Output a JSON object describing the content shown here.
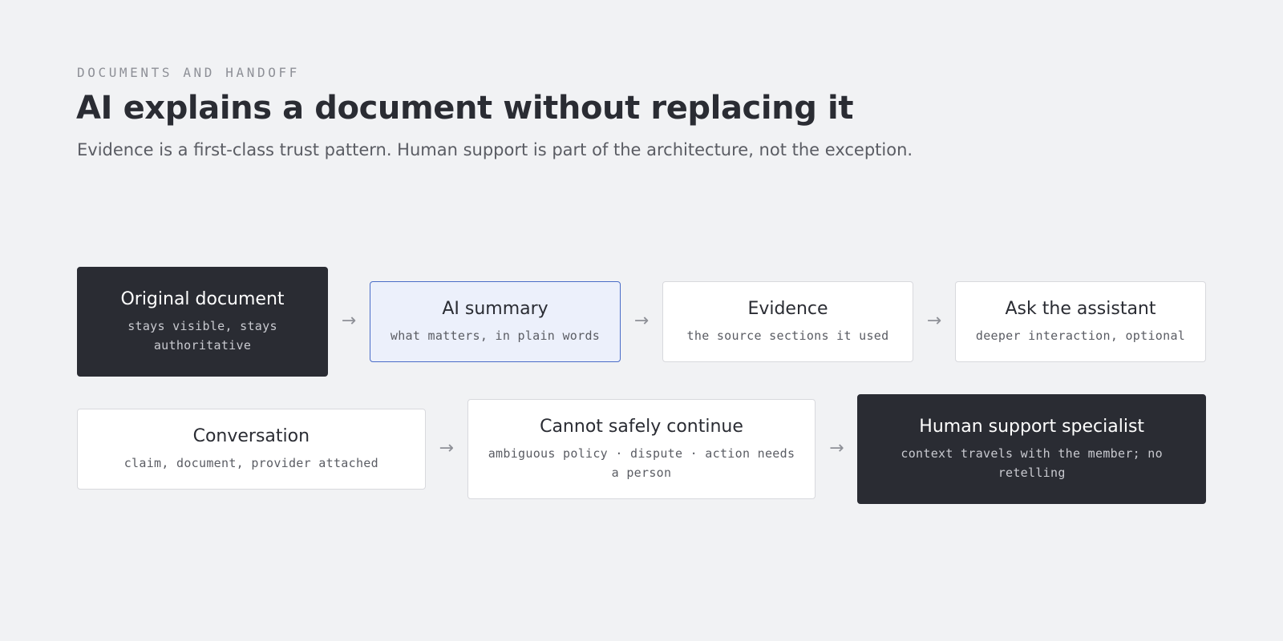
{
  "header": {
    "eyebrow": "DOCUMENTS AND HANDOFF",
    "title": "AI explains a document without replacing it",
    "subtitle": "Evidence is a first-class trust pattern. Human support is part of the architecture, not the exception."
  },
  "flow": {
    "arrow_glyph": "→",
    "row1": [
      {
        "title": "Original document",
        "sub": "stays visible, stays authoritative",
        "style": "dark"
      },
      {
        "title": "AI summary",
        "sub": "what matters, in plain words",
        "style": "highlight"
      },
      {
        "title": "Evidence",
        "sub": "the source sections it used",
        "style": "default"
      },
      {
        "title": "Ask the assistant",
        "sub": "deeper interaction, optional",
        "style": "default"
      }
    ],
    "row2": [
      {
        "title": "Conversation",
        "sub": "claim, document, provider attached",
        "style": "default"
      },
      {
        "title": "Cannot safely continue",
        "sub": "ambiguous policy · dispute · action needs a person",
        "style": "default"
      },
      {
        "title": "Human support specialist",
        "sub": "context travels with the member; no retelling",
        "style": "dark"
      }
    ]
  },
  "colors": {
    "background": "#f1f2f4",
    "dark_node": "#2a2c33",
    "highlight_fill": "#ecf0fb",
    "highlight_border": "#4a6cc7"
  }
}
